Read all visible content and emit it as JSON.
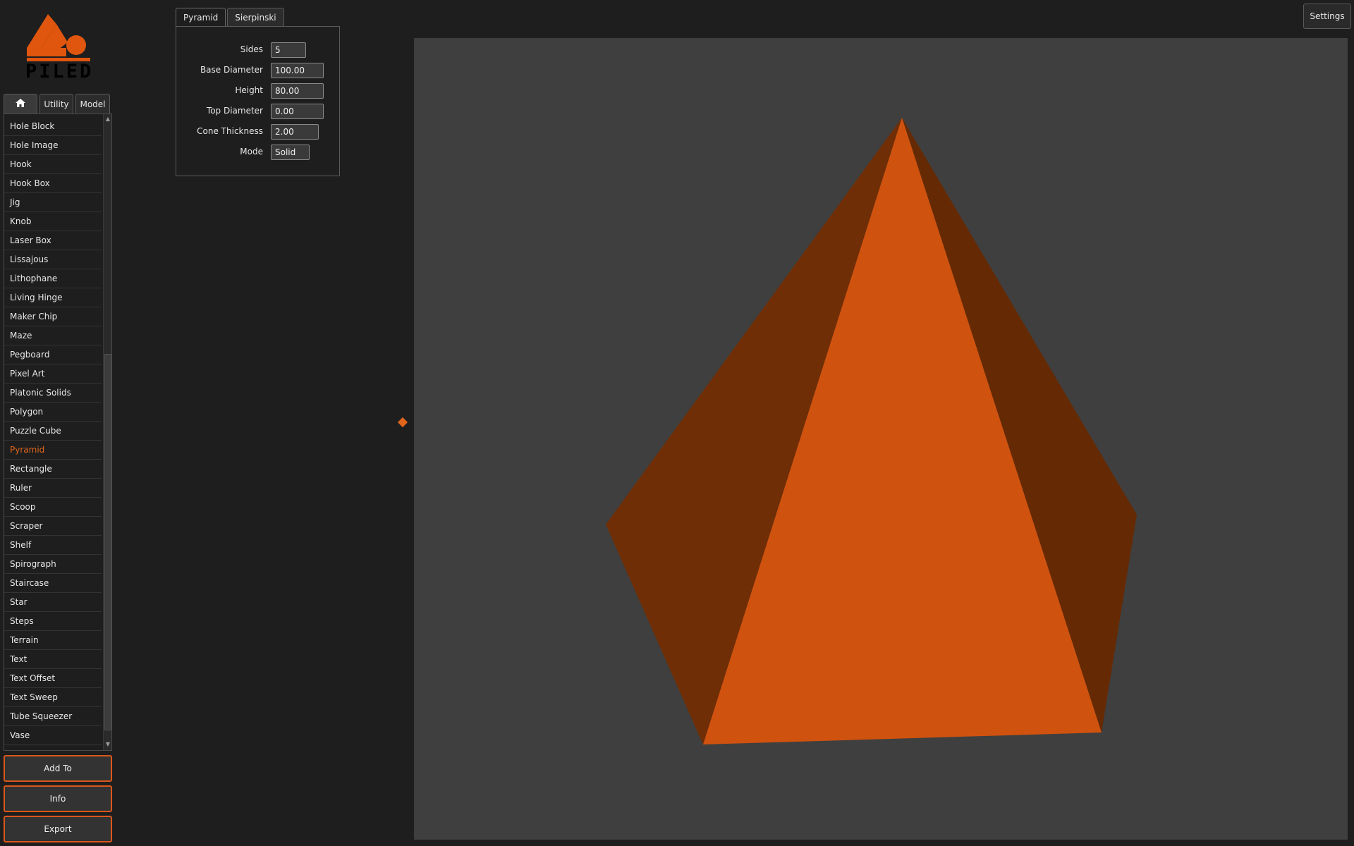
{
  "logo": {
    "text": "PILED",
    "color": "#e0560f"
  },
  "category_tabs": [
    {
      "label": "",
      "icon": "home-icon"
    },
    {
      "label": "Utility"
    },
    {
      "label": "Model"
    }
  ],
  "model_list": {
    "items": [
      "Hole Block",
      "Hole Image",
      "Hook",
      "Hook Box",
      "Jig",
      "Knob",
      "Laser Box",
      "Lissajous",
      "Lithophane",
      "Living Hinge",
      "Maker Chip",
      "Maze",
      "Pegboard",
      "Pixel Art",
      "Platonic Solids",
      "Polygon",
      "Puzzle Cube",
      "Pyramid",
      "Rectangle",
      "Ruler",
      "Scoop",
      "Scraper",
      "Shelf",
      "Spirograph",
      "Staircase",
      "Star",
      "Steps",
      "Terrain",
      "Text",
      "Text Offset",
      "Text Sweep",
      "Tube Squeezer",
      "Vase"
    ],
    "selected": "Pyramid"
  },
  "buttons": {
    "add_to": "Add To",
    "info": "Info",
    "export": "Export",
    "settings": "Settings"
  },
  "param_tabs": [
    "Pyramid",
    "Sierpinski"
  ],
  "params": [
    {
      "label": "Sides",
      "value": "5"
    },
    {
      "label": "Base Diameter",
      "value": "100.00"
    },
    {
      "label": "Height",
      "value": "80.00"
    },
    {
      "label": "Top Diameter",
      "value": "0.00"
    },
    {
      "label": "Cone Thickness",
      "value": "2.00"
    },
    {
      "label": "Mode",
      "value": "Solid"
    }
  ],
  "viewport": {
    "background": "#3f3f3f",
    "face_front": "#d0520f",
    "face_left": "#6f2e05",
    "face_right": "#652a04",
    "accent": "#e0651b"
  }
}
